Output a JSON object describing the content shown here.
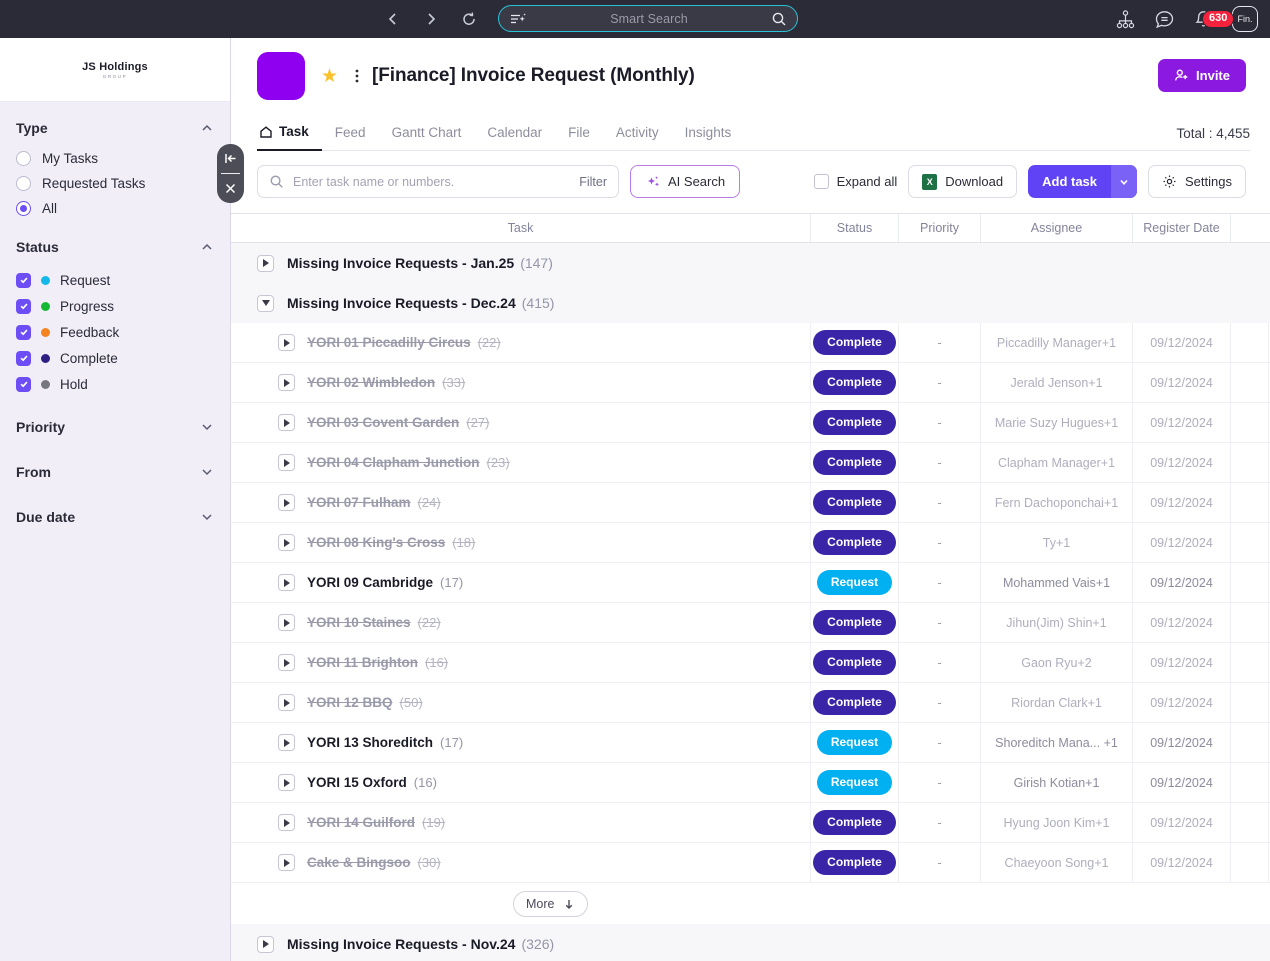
{
  "topbar": {
    "back_icon": "chevron-left-icon",
    "forward_icon": "chevron-right-icon",
    "reload_icon": "reload-icon",
    "search_placeholder": "Smart Search",
    "search_value": "",
    "ai_filter_icon": "ai-filter-icon",
    "search_icon": "search-icon",
    "org_icon": "org-chart-icon",
    "chat_icon": "chat-bubble-icon",
    "bell_icon": "bell-icon",
    "notification_count": "630",
    "avatar_label": "Fin.",
    "accent_border": "#29c3d6",
    "background": "#2b2b38",
    "badge_color": "#f4223c"
  },
  "sidebar": {
    "logo_main": "JS Holdings",
    "logo_sub": "GROUP",
    "collapse_icon": "collapse-left-icon",
    "close_icon": "close-icon",
    "sections": [
      {
        "title": "Type",
        "expanded": true,
        "chevron": "chevron-up-icon",
        "options": [
          {
            "label": "My Tasks",
            "selected": false
          },
          {
            "label": "Requested Tasks",
            "selected": false
          },
          {
            "label": "All",
            "selected": true
          }
        ]
      },
      {
        "title": "Status",
        "expanded": true,
        "chevron": "chevron-up-icon",
        "options": [
          {
            "label": "Request",
            "checked": true,
            "color": "#14b8e8"
          },
          {
            "label": "Progress",
            "checked": true,
            "color": "#14b832"
          },
          {
            "label": "Feedback",
            "checked": true,
            "color": "#f58220"
          },
          {
            "label": "Complete",
            "checked": true,
            "color": "#2e1f85"
          },
          {
            "label": "Hold",
            "checked": true,
            "color": "#77777f"
          }
        ]
      },
      {
        "title": "Priority",
        "expanded": false,
        "chevron": "chevron-down-icon",
        "options": []
      },
      {
        "title": "From",
        "expanded": false,
        "chevron": "chevron-down-icon",
        "options": []
      },
      {
        "title": "Due date",
        "expanded": false,
        "chevron": "chevron-down-icon",
        "options": []
      }
    ],
    "accent": "#6d4df6"
  },
  "project": {
    "icon_color": "#8f00f0",
    "star_icon": "star-icon",
    "kebab_icon": "kebab-menu-icon",
    "title": "[Finance] Invoice Request (Monthly)",
    "invite_label": "Invite",
    "invite_icon": "add-user-icon",
    "invite_color": "#8b19e0"
  },
  "tabs": {
    "items": [
      {
        "label": "Task",
        "active": true,
        "icon": "home-icon"
      },
      {
        "label": "Feed",
        "active": false
      },
      {
        "label": "Gantt Chart",
        "active": false
      },
      {
        "label": "Calendar",
        "active": false
      },
      {
        "label": "File",
        "active": false
      },
      {
        "label": "Activity",
        "active": false
      },
      {
        "label": "Insights",
        "active": false
      }
    ],
    "total": "Total : 4,455"
  },
  "toolbar": {
    "search_placeholder": "Enter task name or numbers.",
    "search_value": "",
    "search_icon": "search-icon",
    "filter_label": "Filter",
    "ai_search_label": "AI Search",
    "ai_search_icon": "sparkle-icon",
    "expand_all_label": "Expand all",
    "expand_all_checked": false,
    "download_label": "Download",
    "download_icon": "excel-icon",
    "add_task_label": "Add task",
    "add_task_caret": "chevron-down-icon",
    "settings_label": "Settings",
    "settings_icon": "gear-icon"
  },
  "table": {
    "columns": [
      "Task",
      "Status",
      "Priority",
      "Assignee",
      "Register Date"
    ],
    "groups": [
      {
        "name": "Missing Invoice Requests - Jan.25",
        "count": "(147)",
        "expanded": false
      },
      {
        "name": "Missing Invoice Requests - Dec.24",
        "count": "(415)",
        "expanded": true
      },
      {
        "name": "Missing Invoice Requests - Nov.24",
        "count": "(326)",
        "expanded": false
      }
    ],
    "rows": [
      {
        "name": "YORI 01 Piccadilly Circus",
        "count": "(22)",
        "status": "Complete",
        "priority": "-",
        "assignee": "Piccadilly Manager+1",
        "date": "09/12/2024",
        "done": true
      },
      {
        "name": "YORI 02 Wimbledon",
        "count": "(33)",
        "status": "Complete",
        "priority": "-",
        "assignee": "Jerald Jenson+1",
        "date": "09/12/2024",
        "done": true
      },
      {
        "name": "YORI 03 Covent Garden",
        "count": "(27)",
        "status": "Complete",
        "priority": "-",
        "assignee": "Marie Suzy Hugues+1",
        "date": "09/12/2024",
        "done": true
      },
      {
        "name": "YORI 04 Clapham Junction",
        "count": "(23)",
        "status": "Complete",
        "priority": "-",
        "assignee": "Clapham Manager+1",
        "date": "09/12/2024",
        "done": true
      },
      {
        "name": "YORI 07 Fulham",
        "count": "(24)",
        "status": "Complete",
        "priority": "-",
        "assignee": "Fern Dachoponchai+1",
        "date": "09/12/2024",
        "done": true
      },
      {
        "name": "YORI 08 King's Cross",
        "count": "(18)",
        "status": "Complete",
        "priority": "-",
        "assignee": "Ty+1",
        "date": "09/12/2024",
        "done": true
      },
      {
        "name": "YORI 09 Cambridge",
        "count": "(17)",
        "status": "Request",
        "priority": "-",
        "assignee": "Mohammed Vais+1",
        "date": "09/12/2024",
        "done": false
      },
      {
        "name": "YORI 10 Staines",
        "count": "(22)",
        "status": "Complete",
        "priority": "-",
        "assignee": "Jihun(Jim) Shin+1",
        "date": "09/12/2024",
        "done": true
      },
      {
        "name": "YORI 11 Brighton",
        "count": "(16)",
        "status": "Complete",
        "priority": "-",
        "assignee": "Gaon Ryu+2",
        "date": "09/12/2024",
        "done": true
      },
      {
        "name": "YORI 12 BBQ",
        "count": "(50)",
        "status": "Complete",
        "priority": "-",
        "assignee": "Riordan Clark+1",
        "date": "09/12/2024",
        "done": true
      },
      {
        "name": "YORI 13 Shoreditch",
        "count": "(17)",
        "status": "Request",
        "priority": "-",
        "assignee": "Shoreditch Mana... +1",
        "date": "09/12/2024",
        "done": false
      },
      {
        "name": "YORI 15 Oxford",
        "count": "(16)",
        "status": "Request",
        "priority": "-",
        "assignee": "Girish Kotian+1",
        "date": "09/12/2024",
        "done": false
      },
      {
        "name": "YORI 14 Guilford",
        "count": "(19)",
        "status": "Complete",
        "priority": "-",
        "assignee": "Hyung Joon Kim+1",
        "date": "09/12/2024",
        "done": true
      },
      {
        "name": "Cake & Bingsoo",
        "count": "(30)",
        "status": "Complete",
        "priority": "-",
        "assignee": "Chaeyoon Song+1",
        "date": "09/12/2024",
        "done": true
      }
    ],
    "more_label": "More",
    "more_icon": "arrow-down-icon",
    "status_colors": {
      "Complete": "#3a24a8",
      "Request": "#00b0f0"
    }
  }
}
